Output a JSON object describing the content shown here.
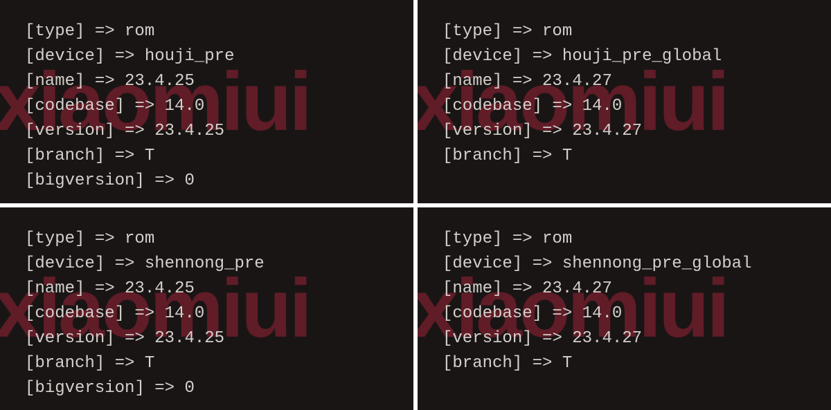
{
  "watermark": "xiaomiui",
  "panels": [
    {
      "entries": [
        {
          "key": "type",
          "value": "rom"
        },
        {
          "key": "device",
          "value": "houji_pre"
        },
        {
          "key": "name",
          "value": "23.4.25"
        },
        {
          "key": "codebase",
          "value": "14.0"
        },
        {
          "key": "version",
          "value": "23.4.25"
        },
        {
          "key": "branch",
          "value": "T"
        },
        {
          "key": "bigversion",
          "value": "0"
        }
      ]
    },
    {
      "entries": [
        {
          "key": "type",
          "value": "rom"
        },
        {
          "key": "device",
          "value": "houji_pre_global"
        },
        {
          "key": "name",
          "value": "23.4.27"
        },
        {
          "key": "codebase",
          "value": "14.0"
        },
        {
          "key": "version",
          "value": "23.4.27"
        },
        {
          "key": "branch",
          "value": "T"
        }
      ]
    },
    {
      "entries": [
        {
          "key": "type",
          "value": "rom"
        },
        {
          "key": "device",
          "value": "shennong_pre"
        },
        {
          "key": "name",
          "value": "23.4.25"
        },
        {
          "key": "codebase",
          "value": "14.0"
        },
        {
          "key": "version",
          "value": "23.4.25"
        },
        {
          "key": "branch",
          "value": "T"
        },
        {
          "key": "bigversion",
          "value": "0"
        }
      ]
    },
    {
      "entries": [
        {
          "key": "type",
          "value": "rom"
        },
        {
          "key": "device",
          "value": "shennong_pre_global"
        },
        {
          "key": "name",
          "value": "23.4.27"
        },
        {
          "key": "codebase",
          "value": "14.0"
        },
        {
          "key": "version",
          "value": "23.4.27"
        },
        {
          "key": "branch",
          "value": "T"
        }
      ]
    }
  ]
}
